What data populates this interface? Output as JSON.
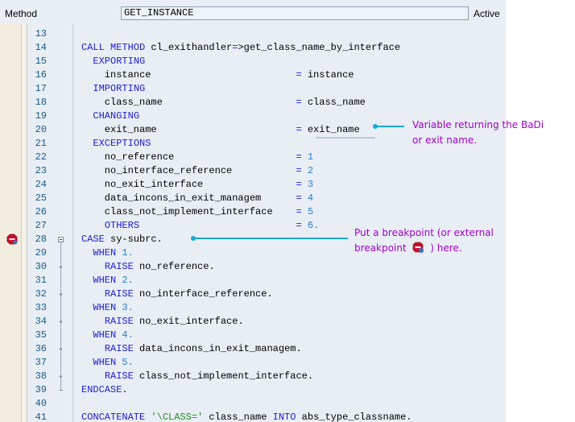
{
  "header": {
    "label": "Method",
    "field_value": "GET_INSTANCE",
    "status": "Active"
  },
  "lines": [
    {
      "n": "13",
      "code": ""
    },
    {
      "n": "14",
      "code": "CALL METHOD cl_exithandler=>get_class_name_by_interface"
    },
    {
      "n": "15",
      "code": "  EXPORTING"
    },
    {
      "n": "16",
      "code": "    instance                         = instance"
    },
    {
      "n": "17",
      "code": "  IMPORTING"
    },
    {
      "n": "18",
      "code": "    class_name                       = class_name"
    },
    {
      "n": "19",
      "code": "  CHANGING"
    },
    {
      "n": "20",
      "code": "    exit_name                        = exit_name"
    },
    {
      "n": "21",
      "code": "  EXCEPTIONS"
    },
    {
      "n": "22",
      "code": "    no_reference                     = 1"
    },
    {
      "n": "23",
      "code": "    no_interface_reference           = 2"
    },
    {
      "n": "24",
      "code": "    no_exit_interface                = 3"
    },
    {
      "n": "25",
      "code": "    data_incons_in_exit_managem      = 4"
    },
    {
      "n": "26",
      "code": "    class_not_implement_interface    = 5"
    },
    {
      "n": "27",
      "code": "    OTHERS                           = 6."
    },
    {
      "n": "28",
      "code": "CASE sy-subrc."
    },
    {
      "n": "29",
      "code": "  WHEN 1."
    },
    {
      "n": "30",
      "code": "    RAISE no_reference."
    },
    {
      "n": "31",
      "code": "  WHEN 2."
    },
    {
      "n": "32",
      "code": "    RAISE no_interface_reference."
    },
    {
      "n": "33",
      "code": "  WHEN 3."
    },
    {
      "n": "34",
      "code": "    RAISE no_exit_interface."
    },
    {
      "n": "35",
      "code": "  WHEN 4."
    },
    {
      "n": "36",
      "code": "    RAISE data_incons_in_exit_managem."
    },
    {
      "n": "37",
      "code": "  WHEN 5."
    },
    {
      "n": "38",
      "code": "    RAISE class_not_implement_interface."
    },
    {
      "n": "39",
      "code": "ENDCASE."
    },
    {
      "n": "40",
      "code": ""
    },
    {
      "n": "41",
      "code": "CONCATENATE '\\CLASS=' class_name INTO abs_type_classname."
    }
  ],
  "annotations": {
    "exit_name_note_1": "Variable returning the BaDi",
    "exit_name_note_2": "or exit name.",
    "breakpoint_note_1": "Put a breakpoint (or external",
    "breakpoint_note_2a": "breakpoint",
    "breakpoint_note_2b": ") here."
  },
  "colors": {
    "keyword": "#1c1cd6",
    "number": "#2b7fd0",
    "string": "#2a8a2a",
    "annotation": "#a000c8",
    "pointer": "#19a7d8"
  },
  "icons": [
    "breakpoint-icon",
    "fold-toggle-icon"
  ]
}
